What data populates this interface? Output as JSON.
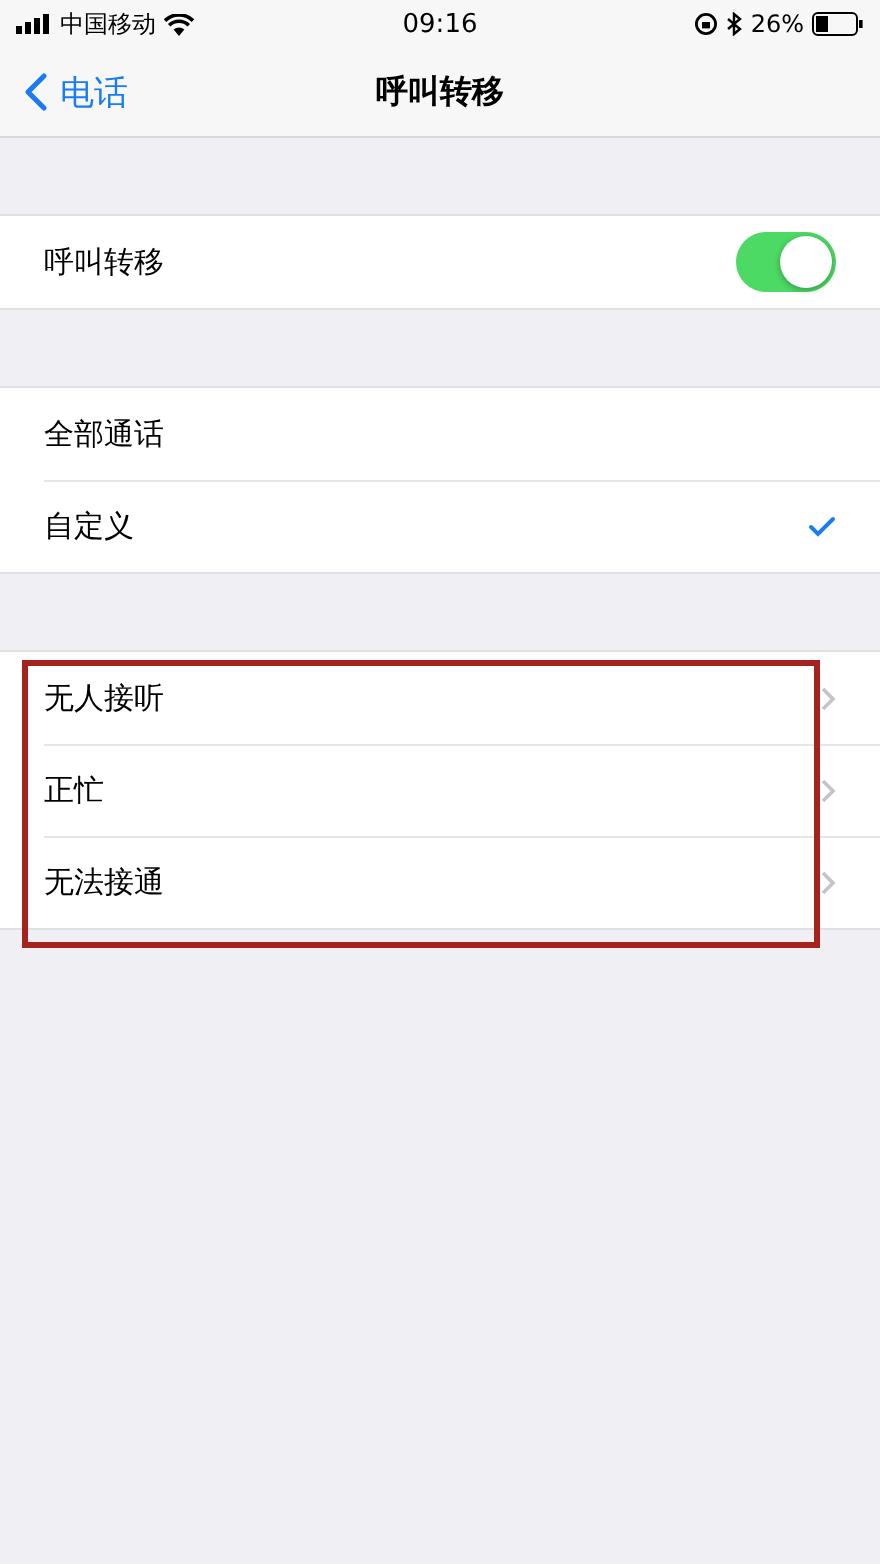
{
  "status_bar": {
    "carrier": "中国移动",
    "time": "09:16",
    "battery": "26%"
  },
  "nav": {
    "back": "电话",
    "title": "呼叫转移"
  },
  "forwarding": {
    "label": "呼叫转移",
    "on": true
  },
  "modes": [
    {
      "label": "全部通话",
      "selected": false
    },
    {
      "label": "自定义",
      "selected": true
    }
  ],
  "conditions": {
    "highlighted": true,
    "items": [
      {
        "label": "无人接听"
      },
      {
        "label": "正忙"
      },
      {
        "label": "无法接通"
      }
    ]
  }
}
